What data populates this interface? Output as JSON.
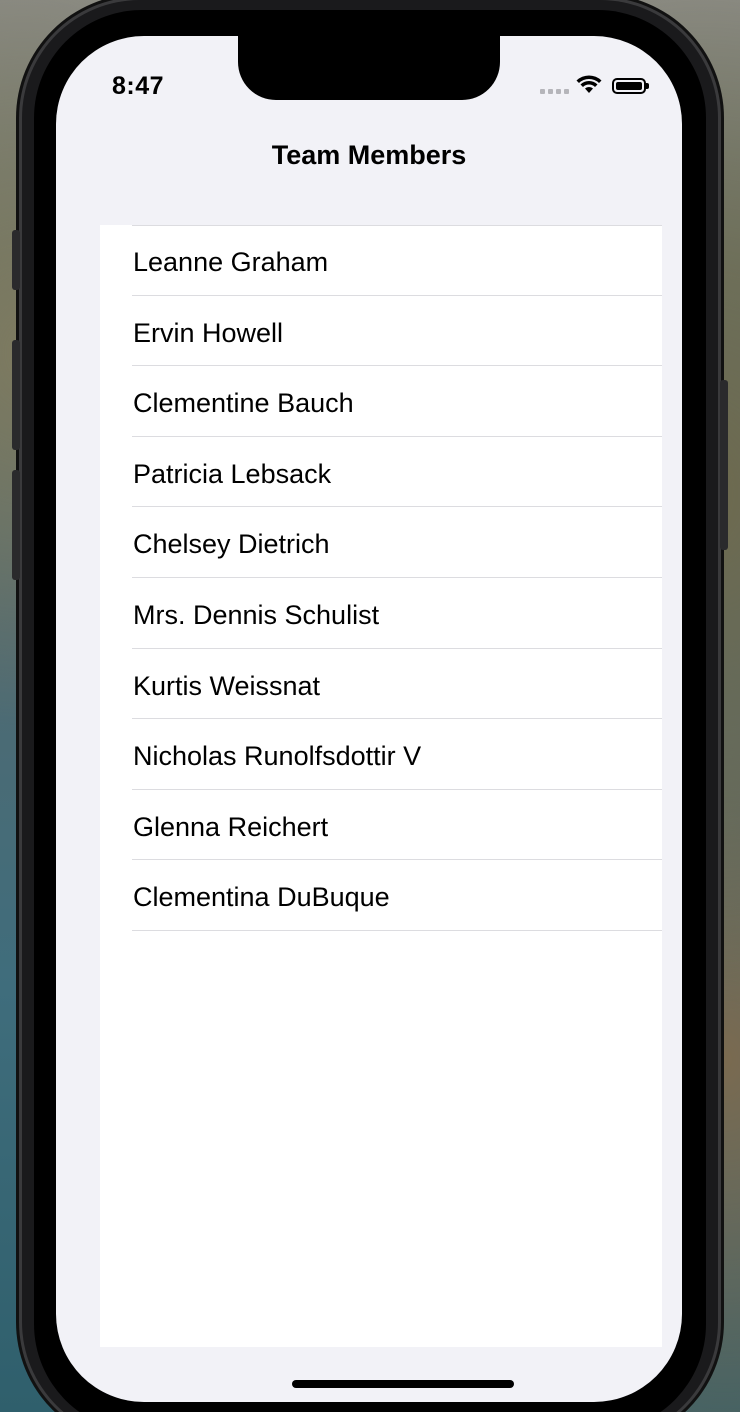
{
  "status_bar": {
    "time": "8:47",
    "icons": [
      "cellular-signal-icon",
      "wifi-icon",
      "battery-icon"
    ]
  },
  "navigation": {
    "title": "Team Members"
  },
  "team_list": {
    "items": [
      "Leanne Graham",
      "Ervin Howell",
      "Clementine Bauch",
      "Patricia Lebsack",
      "Chelsey Dietrich",
      "Mrs. Dennis Schulist",
      "Kurtis Weissnat",
      "Nicholas Runolfsdottir V",
      "Glenna Reichert",
      "Clementina DuBuque"
    ]
  },
  "colors": {
    "background": "#f2f2f7",
    "list_background": "#ffffff",
    "separator": "#dcdce0",
    "text": "#000000"
  }
}
